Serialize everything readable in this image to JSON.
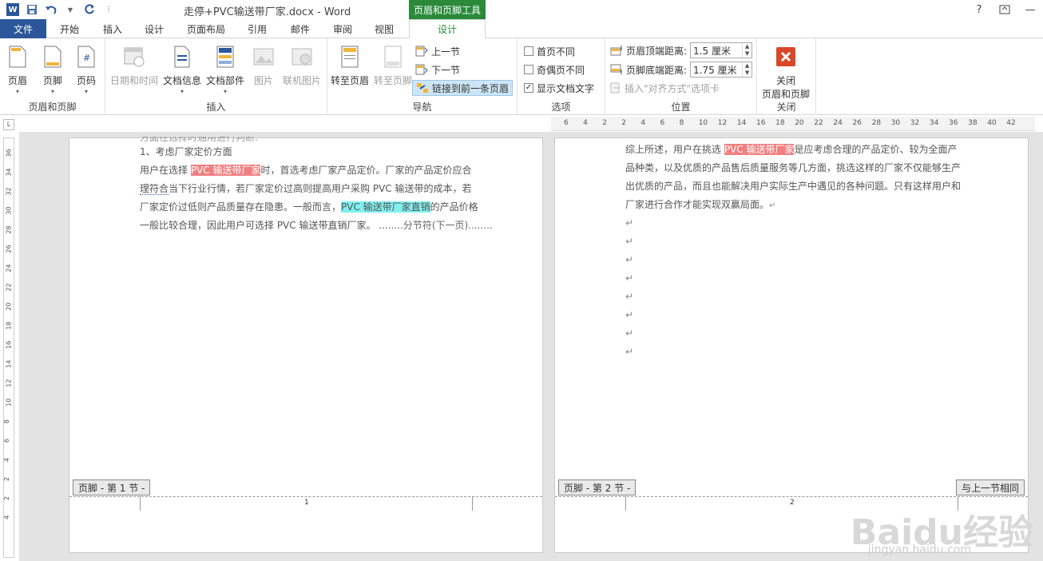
{
  "titlebar": {
    "doc_title": "走停+PVC输送带厂家.docx - Word",
    "context_tab_title": "页眉和页脚工具",
    "help": "?",
    "minimize": "—",
    "close": "✕"
  },
  "tabs": {
    "file": "文件",
    "items": [
      "开始",
      "插入",
      "设计",
      "页面布局",
      "引用",
      "邮件",
      "审阅",
      "视图"
    ],
    "design": "设计"
  },
  "ribbon": {
    "hf_group": {
      "label": "页眉和页脚",
      "header": "页眉",
      "footer": "页脚",
      "page_num": "页码"
    },
    "insert_group": {
      "label": "插入",
      "datetime": "日期和时间",
      "docinfo": "文档信息",
      "docparts": "文档部件",
      "picture": "图片",
      "online_pic": "联机图片"
    },
    "nav_group": {
      "label": "导航",
      "goto_header": "转至页眉",
      "goto_footer": "转至页脚",
      "prev": "上一节",
      "next": "下一节",
      "link_prev": "链接到前一条页眉"
    },
    "options_group": {
      "label": "选项",
      "diff_first": "首页不同",
      "diff_odd_even": "奇偶页不同",
      "show_text": "显示文档文字",
      "show_text_checked": "✓"
    },
    "position_group": {
      "label": "位置",
      "header_dist_label": "页眉顶端距离:",
      "header_dist": "1.5 厘米",
      "footer_dist_label": "页脚底端距离:",
      "footer_dist": "1.75 厘米",
      "insert_align": "插入\"对齐方式\"选项卡"
    },
    "close_group": {
      "label": "关闭",
      "close_line1": "关闭",
      "close_line2": "页眉和页脚"
    }
  },
  "ruler": {
    "h_numbers": [
      "6",
      "4",
      "2",
      "2",
      "4",
      "6",
      "8",
      "10",
      "12",
      "14",
      "16",
      "18",
      "20",
      "22",
      "24",
      "26",
      "28",
      "30",
      "32",
      "34",
      "36",
      "38",
      "40",
      "42"
    ],
    "v_numbers": [
      "36",
      "34",
      "32",
      "30",
      "28",
      "26",
      "24",
      "22",
      "20",
      "18",
      "16",
      "14",
      "12",
      "10",
      "8",
      "6",
      "4",
      "2",
      "2",
      "4"
    ],
    "corner": "L"
  },
  "page1": {
    "cut_line": "方面在选择时通用进行判断:",
    "item_title": "1、考虑厂家定价方面",
    "line1_a": "用户在选择 ",
    "line1_hl": "PVC 输送带厂家",
    "line1_b": "时，首选考虑厂家产品定价。厂家的产品定价应合",
    "line2_a": "理符合",
    "line2_b": "当下行业行情，若厂家定价过高则提高用户采购 PVC 输送带的成本，若",
    "line3_a": "厂家定价过低则产品质量存在隐患。一般而言，",
    "line3_hl": "PVC 输送带厂家直销",
    "line3_b": "的产品价格",
    "line4": "一般比较合理，因此用户可选择 PVC 输送带直销厂家。",
    "section_break": "........分节符(下一页)........",
    "footer_tag": "页脚 - 第 1 节 -",
    "page_number": "1"
  },
  "page2": {
    "line1_a": "综上所述，用户在挑选 ",
    "line1_hl": "PVC 输送带厂家",
    "line1_b": "是应考虑合理的产品定价、较为全面产",
    "line2": "品种类，以及优质的产品售后质量服务等几方面，挑选这样的厂家不仅能够生产",
    "line3": "出优质的产品，而且也能解决用户实际生产中遇见的各种问题。只有这样用户和",
    "line4": "厂家进行合作才能实现双赢局面。",
    "para_mark": "↵",
    "footer_tag": "页脚 - 第 2 节 -",
    "same_as_prev": "与上一节相同",
    "page_number": "2"
  },
  "watermark": {
    "text": "Baidu经验",
    "sub": "jingyan.baidu.com"
  }
}
